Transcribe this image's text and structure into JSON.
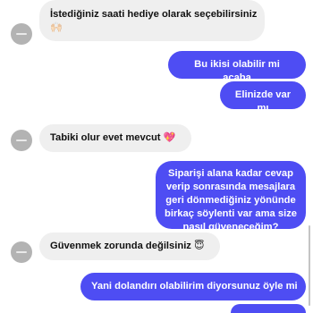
{
  "messages": {
    "m1": {
      "text": "İstediğiniz saati hediye olarak seçebilirsiniz",
      "emoji": "🙌🏻"
    },
    "m2": {
      "text": "Bu ikisi olabilir mi acaba"
    },
    "m3": {
      "text": "Elinizde var mı"
    },
    "m4": {
      "text": "Tabiki olur evet mevcut",
      "emoji": "💖"
    },
    "m5": {
      "text": "Siparişi alana kadar cevap verip sonrasında mesajlara geri dönmediğiniz yönünde birkaç söylenti var ama size nasıl güveneceğim?"
    },
    "m6": {
      "text": "Güvenmek zorunda değilsiniz",
      "emoji": "😇"
    },
    "m7": {
      "text": "Yani dolandırı olabilirim diyorsunuz öyle mi"
    }
  },
  "colors": {
    "incoming_bubble": "#efefef",
    "outgoing_bubble": "#4e4df3",
    "avatar": "#b3b3b3"
  },
  "icons": {
    "avatar": "profile-avatar-icon"
  }
}
